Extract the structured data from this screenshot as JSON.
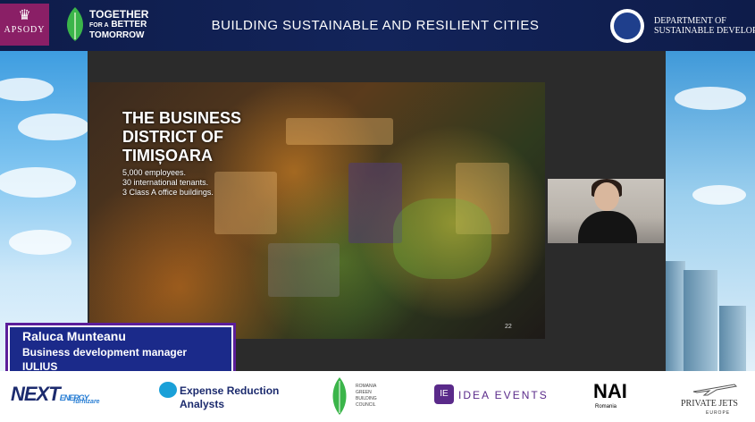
{
  "header": {
    "title": "BUILDING SUSTAINABLE AND RESILIENT CITIES",
    "logo_left_text": "APSODY",
    "partner_logo_line1": "TOGETHER",
    "partner_logo_line2_small": "FOR A",
    "partner_logo_line2": "BETTER",
    "partner_logo_line3": "TOMORROW",
    "dept_line1": "DEPARTMENT OF",
    "dept_line2": "SUSTAINABLE DEVELOPM"
  },
  "slide": {
    "title_line1": "THE BUSINESS",
    "title_line2": "DISTRICT OF",
    "title_line3": "TIMIȘOARA",
    "stat1": "5,000 employees.",
    "stat2": "30 international tenants.",
    "stat3": "3 Class A office buildings.",
    "page_number": "22"
  },
  "speaker": {
    "name": "Raluca Munteanu",
    "role": "Business development manager",
    "company": "IULIUS"
  },
  "sponsors": {
    "next_main": "NEXT",
    "next_energy": "ENERGY",
    "next_furnizare": "furnizare",
    "era_line1": "Expense Reduction",
    "era_line2": "Analysts",
    "rgbc_line1": "ROMANIA",
    "rgbc_line2": "GREEN",
    "rgbc_line3": "BUILDING",
    "rgbc_line4": "COUNCIL",
    "idea_icon": "IE",
    "idea": "IDEA EVENTS",
    "nai": "NAI",
    "nai_sub": "Romania",
    "jets": "PRIVATE JETS",
    "jets_sub": "EUROPE"
  },
  "colors": {
    "header_bg": "#0e1c4a",
    "name_box_bg": "#1b2a8a",
    "name_box_border": "#5b1e9a",
    "leaf_green": "#3bb54a"
  }
}
